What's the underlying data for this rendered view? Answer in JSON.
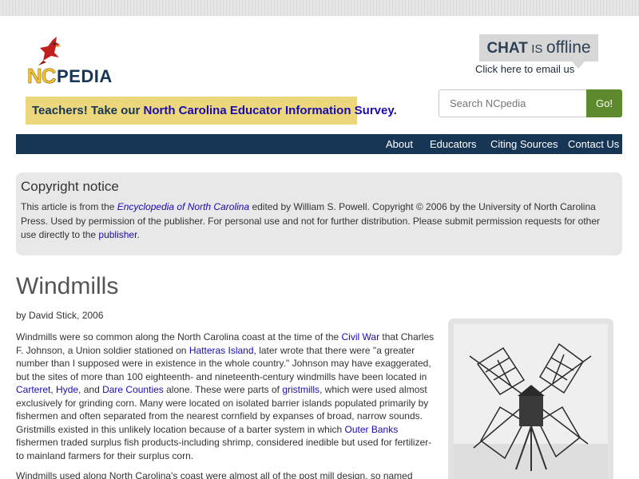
{
  "brand": {
    "nc": "NC",
    "pedia": "PEDIA"
  },
  "chat": {
    "word1": "CHAT",
    "word2": "IS",
    "word3": "offline",
    "email_link": "Click here to email us"
  },
  "survey": {
    "prefix": "Teachers! Take our ",
    "link": "North Carolina Educator Information Survey",
    "suffix": "."
  },
  "search": {
    "placeholder": "Search NCpedia",
    "button": "Go!"
  },
  "nav": {
    "items": [
      "About",
      "Educators",
      "Citing Sources",
      "Contact Us"
    ]
  },
  "notice": {
    "heading": "Copyright notice",
    "p1": "This article is from the ",
    "book": "Encyclopedia of North Carolina",
    "p2": " edited by William S. Powell. Copyright © 2006 by the University of North Carolina Press. Used by permission of the publisher. For personal use and not for further distribution. Please submit permission requests for other use directly to the ",
    "publisher_link": "publisher",
    "p3": "."
  },
  "article": {
    "title": "Windmills",
    "byline": "by David Stick, 2006",
    "para1": {
      "t1": "Windmills were so common along the North Carolina coast at the time of the ",
      "l1": "Civil War",
      "t2": " that Charles F. Johnson, a Union soldier stationed on ",
      "l2": "Hatteras Island",
      "t3": ", later wrote that there were \"a greater number than I supposed were in existence in the whole country.\" Johnson may have exaggerated, but the sites of more than 100 eighteenth- and nineteenth-century windmills have been located in ",
      "l3": "Carteret",
      "t4": ", ",
      "l4": "Hyde",
      "t5": ", and ",
      "l5": "Dare Counties",
      "t6": " alone. These were parts of ",
      "l6": "gristmills",
      "t7": ", which were used almost exclusively for grinding corn. Many were located on isolated barrier islands populated primarily by fishermen and often separated from the nearest cornfield by expanses of broad, narrow sounds. Gristmills existed in this unlikely location because of a barter system in which ",
      "l7": "Outer Banks",
      "t8": " fishermen traded surplus fish products-including shrimp, considered inedible but used for fertilizer-to mainland farmers for their surplus corn."
    },
    "para2": "Windmills used along North Carolina's coast were almost all of the post mill design, so named because a"
  },
  "colors": {
    "navy": "#173655",
    "survey_bg": "#ecd77c",
    "go_green": "#5e8a2d",
    "link": "#1a0dab"
  }
}
